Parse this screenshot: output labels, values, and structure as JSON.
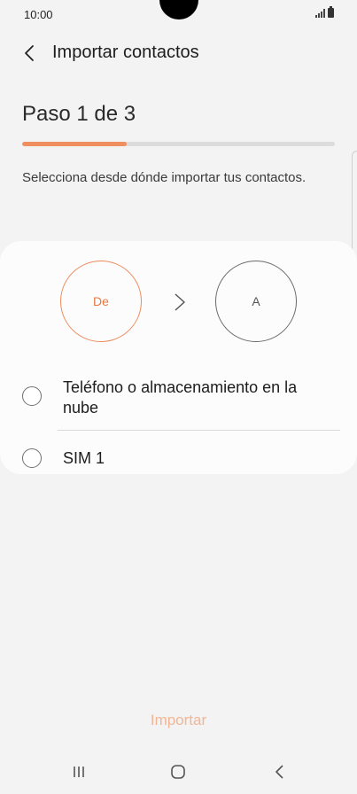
{
  "status_bar": {
    "time": "10:00"
  },
  "header": {
    "back_icon": "chevron-left-icon",
    "title": "Importar contactos"
  },
  "step": {
    "title": "Paso 1 de 3",
    "progress_fraction": 0.333,
    "progress_color": "#ef8e5e"
  },
  "instruction": "Selecciona desde dónde importar tus contactos.",
  "flow": {
    "from_label": "De",
    "to_label": "A",
    "accent_color": "#ee8b5c"
  },
  "options": [
    {
      "label": "Teléfono o almacenamiento en la nube",
      "selected": false
    },
    {
      "label": "SIM 1",
      "selected": false
    }
  ],
  "import_button": {
    "label": "Importar",
    "enabled": false
  },
  "nav_bar": {
    "recents_icon": "recents-icon",
    "home_icon": "home-icon",
    "back_icon": "back-icon"
  }
}
